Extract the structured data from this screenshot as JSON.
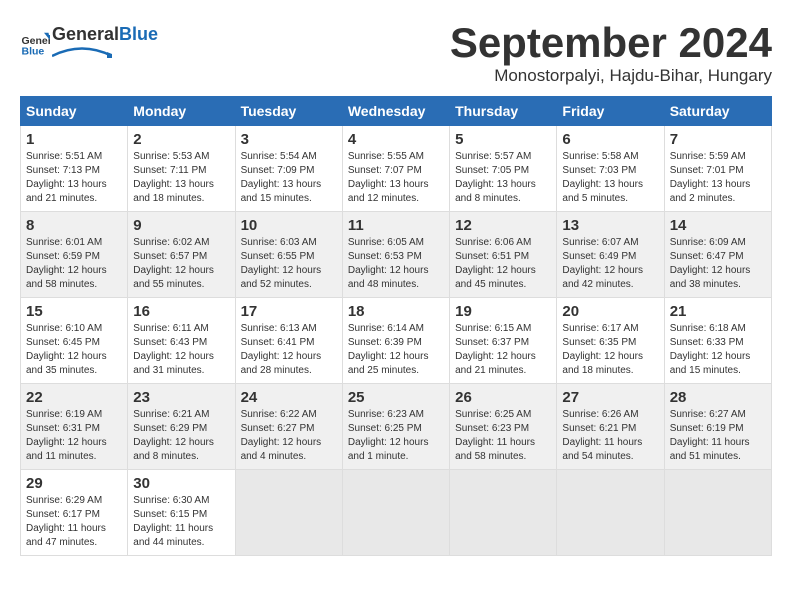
{
  "header": {
    "logo_text_general": "General",
    "logo_text_blue": "Blue",
    "month_title": "September 2024",
    "subtitle": "Monostorpalyi, Hajdu-Bihar, Hungary"
  },
  "calendar": {
    "days_of_week": [
      "Sunday",
      "Monday",
      "Tuesday",
      "Wednesday",
      "Thursday",
      "Friday",
      "Saturday"
    ],
    "weeks": [
      [
        {
          "day": "",
          "info": ""
        },
        {
          "day": "2",
          "info": "Sunrise: 5:53 AM\nSunset: 7:11 PM\nDaylight: 13 hours\nand 18 minutes."
        },
        {
          "day": "3",
          "info": "Sunrise: 5:54 AM\nSunset: 7:09 PM\nDaylight: 13 hours\nand 15 minutes."
        },
        {
          "day": "4",
          "info": "Sunrise: 5:55 AM\nSunset: 7:07 PM\nDaylight: 13 hours\nand 12 minutes."
        },
        {
          "day": "5",
          "info": "Sunrise: 5:57 AM\nSunset: 7:05 PM\nDaylight: 13 hours\nand 8 minutes."
        },
        {
          "day": "6",
          "info": "Sunrise: 5:58 AM\nSunset: 7:03 PM\nDaylight: 13 hours\nand 5 minutes."
        },
        {
          "day": "7",
          "info": "Sunrise: 5:59 AM\nSunset: 7:01 PM\nDaylight: 13 hours\nand 2 minutes."
        }
      ],
      [
        {
          "day": "1",
          "info": "Sunrise: 5:51 AM\nSunset: 7:13 PM\nDaylight: 13 hours\nand 21 minutes."
        },
        {
          "day": "9",
          "info": "Sunrise: 6:02 AM\nSunset: 6:57 PM\nDaylight: 12 hours\nand 55 minutes."
        },
        {
          "day": "10",
          "info": "Sunrise: 6:03 AM\nSunset: 6:55 PM\nDaylight: 12 hours\nand 52 minutes."
        },
        {
          "day": "11",
          "info": "Sunrise: 6:05 AM\nSunset: 6:53 PM\nDaylight: 12 hours\nand 48 minutes."
        },
        {
          "day": "12",
          "info": "Sunrise: 6:06 AM\nSunset: 6:51 PM\nDaylight: 12 hours\nand 45 minutes."
        },
        {
          "day": "13",
          "info": "Sunrise: 6:07 AM\nSunset: 6:49 PM\nDaylight: 12 hours\nand 42 minutes."
        },
        {
          "day": "14",
          "info": "Sunrise: 6:09 AM\nSunset: 6:47 PM\nDaylight: 12 hours\nand 38 minutes."
        }
      ],
      [
        {
          "day": "8",
          "info": "Sunrise: 6:01 AM\nSunset: 6:59 PM\nDaylight: 12 hours\nand 58 minutes."
        },
        {
          "day": "16",
          "info": "Sunrise: 6:11 AM\nSunset: 6:43 PM\nDaylight: 12 hours\nand 31 minutes."
        },
        {
          "day": "17",
          "info": "Sunrise: 6:13 AM\nSunset: 6:41 PM\nDaylight: 12 hours\nand 28 minutes."
        },
        {
          "day": "18",
          "info": "Sunrise: 6:14 AM\nSunset: 6:39 PM\nDaylight: 12 hours\nand 25 minutes."
        },
        {
          "day": "19",
          "info": "Sunrise: 6:15 AM\nSunset: 6:37 PM\nDaylight: 12 hours\nand 21 minutes."
        },
        {
          "day": "20",
          "info": "Sunrise: 6:17 AM\nSunset: 6:35 PM\nDaylight: 12 hours\nand 18 minutes."
        },
        {
          "day": "21",
          "info": "Sunrise: 6:18 AM\nSunset: 6:33 PM\nDaylight: 12 hours\nand 15 minutes."
        }
      ],
      [
        {
          "day": "15",
          "info": "Sunrise: 6:10 AM\nSunset: 6:45 PM\nDaylight: 12 hours\nand 35 minutes."
        },
        {
          "day": "23",
          "info": "Sunrise: 6:21 AM\nSunset: 6:29 PM\nDaylight: 12 hours\nand 8 minutes."
        },
        {
          "day": "24",
          "info": "Sunrise: 6:22 AM\nSunset: 6:27 PM\nDaylight: 12 hours\nand 4 minutes."
        },
        {
          "day": "25",
          "info": "Sunrise: 6:23 AM\nSunset: 6:25 PM\nDaylight: 12 hours\nand 1 minute."
        },
        {
          "day": "26",
          "info": "Sunrise: 6:25 AM\nSunset: 6:23 PM\nDaylight: 11 hours\nand 58 minutes."
        },
        {
          "day": "27",
          "info": "Sunrise: 6:26 AM\nSunset: 6:21 PM\nDaylight: 11 hours\nand 54 minutes."
        },
        {
          "day": "28",
          "info": "Sunrise: 6:27 AM\nSunset: 6:19 PM\nDaylight: 11 hours\nand 51 minutes."
        }
      ],
      [
        {
          "day": "22",
          "info": "Sunrise: 6:19 AM\nSunset: 6:31 PM\nDaylight: 12 hours\nand 11 minutes."
        },
        {
          "day": "30",
          "info": "Sunrise: 6:30 AM\nSunset: 6:15 PM\nDaylight: 11 hours\nand 44 minutes."
        },
        {
          "day": "",
          "info": ""
        },
        {
          "day": "",
          "info": ""
        },
        {
          "day": "",
          "info": ""
        },
        {
          "day": "",
          "info": ""
        },
        {
          "day": "",
          "info": ""
        }
      ],
      [
        {
          "day": "29",
          "info": "Sunrise: 6:29 AM\nSunset: 6:17 PM\nDaylight: 11 hours\nand 47 minutes."
        },
        {
          "day": "",
          "info": ""
        },
        {
          "day": "",
          "info": ""
        },
        {
          "day": "",
          "info": ""
        },
        {
          "day": "",
          "info": ""
        },
        {
          "day": "",
          "info": ""
        },
        {
          "day": "",
          "info": ""
        }
      ]
    ]
  }
}
